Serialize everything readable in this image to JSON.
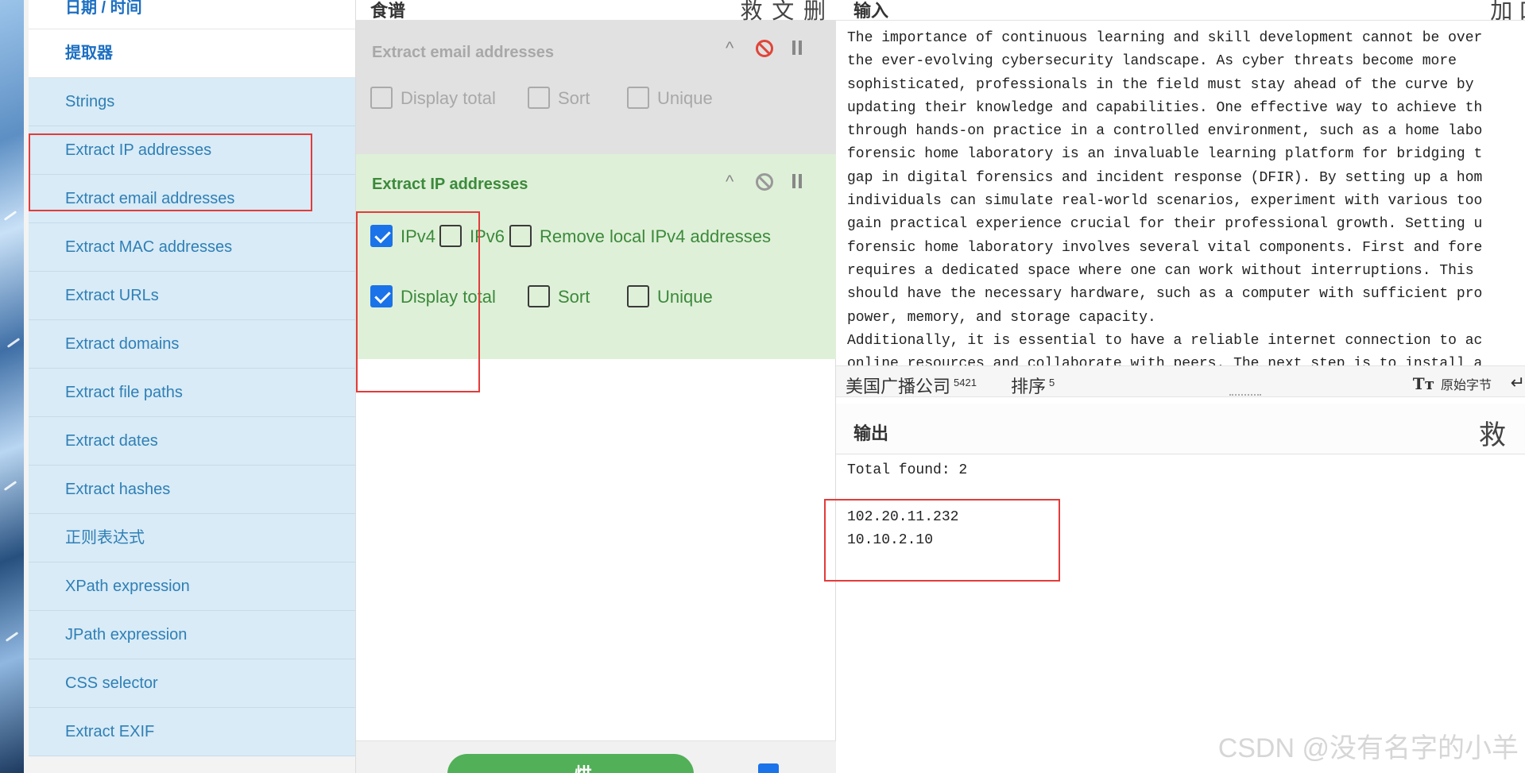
{
  "operations": {
    "items": [
      {
        "label": "日期 / 时间",
        "type": "category"
      },
      {
        "label": "提取器",
        "type": "category"
      },
      {
        "label": "Strings",
        "type": "op"
      },
      {
        "label": "Extract IP addresses",
        "type": "op"
      },
      {
        "label": "Extract email addresses",
        "type": "op"
      },
      {
        "label": "Extract MAC addresses",
        "type": "op"
      },
      {
        "label": "Extract URLs",
        "type": "op"
      },
      {
        "label": "Extract domains",
        "type": "op"
      },
      {
        "label": "Extract file paths",
        "type": "op"
      },
      {
        "label": "Extract dates",
        "type": "op"
      },
      {
        "label": "Extract hashes",
        "type": "op"
      },
      {
        "label": "正则表达式",
        "type": "op"
      },
      {
        "label": "XPath expression",
        "type": "op"
      },
      {
        "label": "JPath expression",
        "type": "op"
      },
      {
        "label": "CSS selector",
        "type": "op"
      },
      {
        "label": "Extract EXIF",
        "type": "op"
      }
    ]
  },
  "recipe": {
    "title": "食谱",
    "header_icons": "救 文 删",
    "email_op": {
      "title": "Extract email addresses",
      "options": {
        "display_total": "Display total",
        "sort": "Sort",
        "unique": "Unique"
      }
    },
    "ip_op": {
      "title": "Extract IP addresses",
      "options": {
        "ipv4": "IPv4",
        "ipv4_checked": true,
        "ipv6": "IPv6",
        "ipv6_checked": false,
        "remove_local": "Remove local IPv4 addresses",
        "remove_local_checked": false,
        "display_total": "Display total",
        "display_total_checked": true,
        "sort": "Sort",
        "sort_checked": false,
        "unique": "Unique",
        "unique_checked": false
      }
    },
    "bake_label": "烘"
  },
  "input": {
    "title": "输入",
    "header_icons": "加 口 ",
    "lines": [
      "The importance of continuous learning and skill development cannot be over",
      "the ever-evolving cybersecurity landscape. As cyber threats become more",
      "sophisticated, professionals in the field must stay ahead of the curve by",
      "updating their knowledge and capabilities. One effective way to achieve th",
      "through hands-on practice in a controlled environment, such as a home labo",
      "forensic home laboratory is an invaluable learning platform for bridging t",
      "gap in digital forensics and incident response (DFIR). By setting up a hom",
      "individuals can simulate real-world scenarios, experiment with various too",
      "gain practical experience crucial for their professional growth. Setting u",
      "forensic home laboratory involves several vital components. First and fore",
      "requires a dedicated space where one can work without interruptions. This",
      "should have the necessary hardware, such as a computer with sufficient pro",
      "power, memory, and storage capacity.",
      "Additionally, it is essential to have a reliable internet connection to ac",
      "online resources and collaborate with peers. The next step is to install a"
    ],
    "status": {
      "length_label": "美国广播公司",
      "length_value": "5421",
      "lines_label": "排序",
      "lines_value": "5",
      "encoding": "原始字节",
      "encoding_icon": "Tт",
      "eol_icon": "↵"
    }
  },
  "output": {
    "title": "输出",
    "header_icons": "救 ",
    "lines": [
      "Total found: 2",
      "",
      "102.20.11.232",
      "10.10.2.10"
    ]
  },
  "watermark": "CSDN @没有名字的小羊",
  "colors": {
    "ops_bg": "#d8ebf6",
    "ops_text": "#2f7fb6",
    "disabled_card": "#e1e1e1",
    "active_card": "#dff0d8",
    "active_text": "#3b8a3b",
    "checkbox_checked": "#1a73e8",
    "annotation": "#e33b3b",
    "bake_button": "#52b058"
  }
}
